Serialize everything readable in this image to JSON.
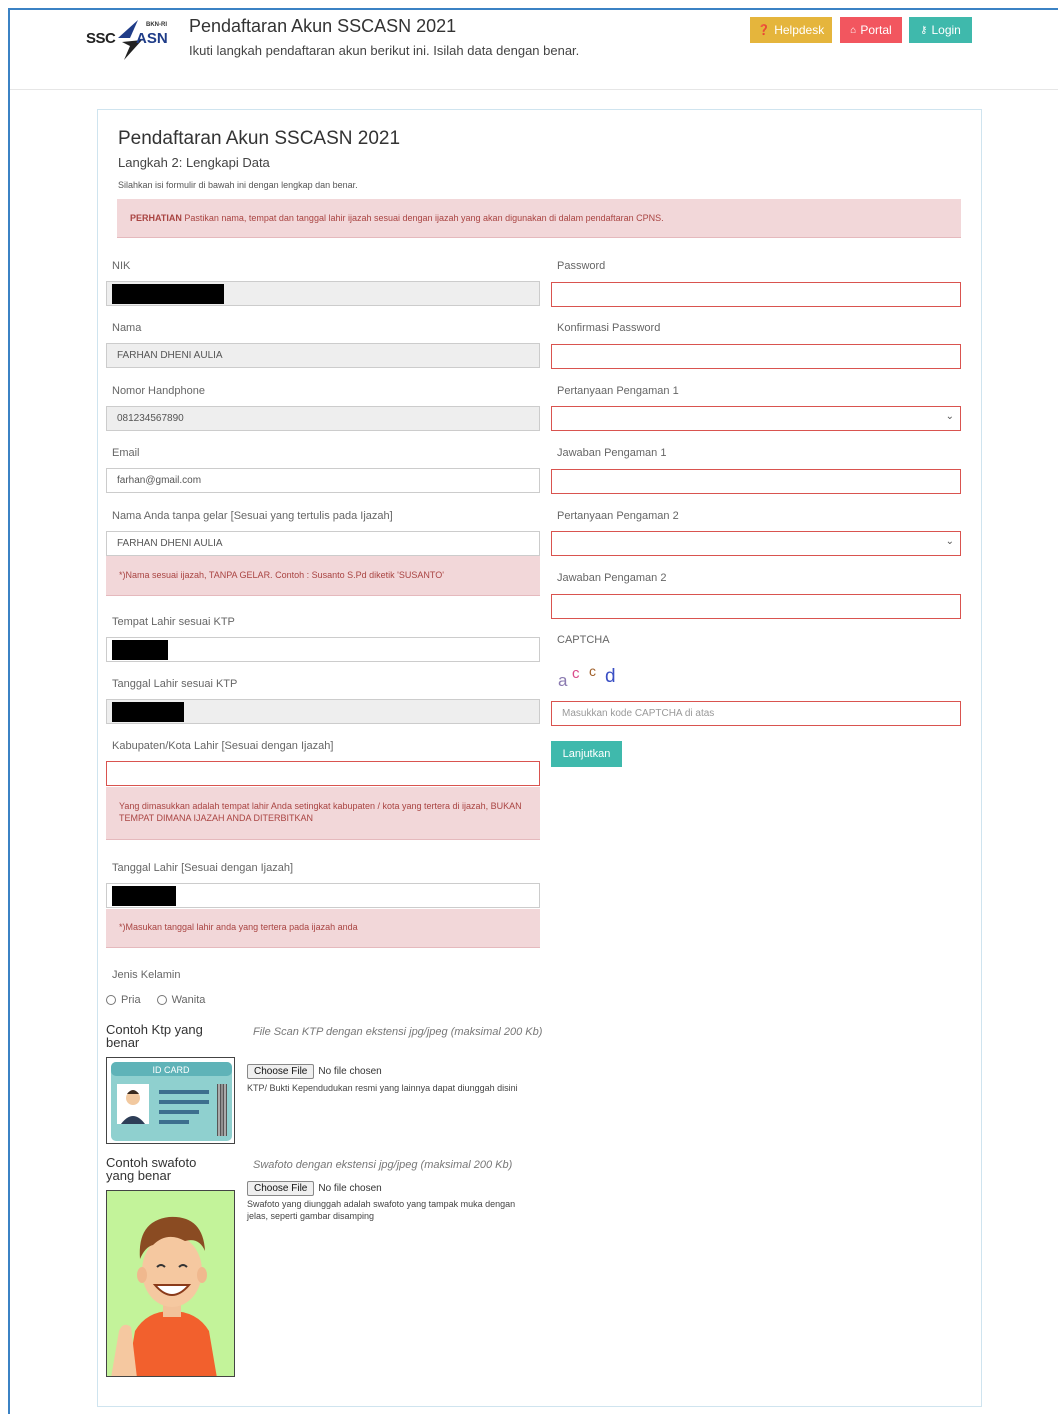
{
  "header": {
    "logo_left": "SSC",
    "logo_right": "ASN",
    "logo_small": "BKN-RI",
    "title": "Pendaftaran Akun SSCASN 2021",
    "subtitle": "Ikuti langkah pendaftaran akun berikut ini. Isilah data dengan benar.",
    "buttons": {
      "helpdesk": "Helpdesk",
      "portal": "Portal",
      "login": "Login"
    },
    "colors": {
      "helpdesk": "#e5b53c",
      "portal": "#f2565f",
      "login": "#3fb9ac"
    }
  },
  "form": {
    "title": "Pendaftaran Akun SSCASN 2021",
    "step": "Langkah 2: Lengkapi Data",
    "instruction": "Silahkan isi formulir di bawah ini dengan lengkap dan benar.",
    "alert_label": "PERHATIAN",
    "alert_text": "Pastikan nama, tempat dan tanggal lahir ijazah sesuai dengan ijazah yang akan digunakan di dalam pendaftaran CPNS.",
    "left": {
      "nik_label": "NIK",
      "nama_label": "Nama",
      "nama_value": "FARHAN DHENI AULIA",
      "hp_label": "Nomor Handphone",
      "hp_value": "081234567890",
      "email_label": "Email",
      "email_value": "farhan@gmail.com",
      "nama_ijazah_label": "Nama Anda tanpa gelar [Sesuai yang tertulis pada Ijazah]",
      "nama_ijazah_value": "FARHAN DHENI AULIA",
      "nama_ijazah_help": "*)Nama sesuai ijazah, TANPA GELAR. Contoh : Susanto S.Pd diketik 'SUSANTO'",
      "tempat_lahir_label": "Tempat Lahir sesuai KTP",
      "tanggal_lahir_label": "Tanggal Lahir sesuai KTP",
      "kab_label": "Kabupaten/Kota Lahir [Sesuai dengan Ijazah]",
      "kab_help": "Yang dimasukkan adalah tempat lahir Anda setingkat kabupaten / kota yang tertera di ijazah, BUKAN TEMPAT DIMANA IJAZAH ANDA DITERBITKAN",
      "tgl_ijazah_label": "Tanggal Lahir [Sesuai dengan Ijazah]",
      "tgl_ijazah_help": "*)Masukan tanggal lahir anda yang tertera pada ijazah anda",
      "gender_label": "Jenis Kelamin",
      "gender_options": [
        "Pria",
        "Wanita"
      ],
      "ktp_example_title": "Contoh Ktp yang benar",
      "ktp_desc": "File Scan KTP dengan ekstensi jpg/jpeg (maksimal 200 Kb)",
      "ktp_note": "KTP/ Bukti Kependudukan resmi yang lainnya dapat diunggah disini",
      "ktp_card_label": "ID CARD",
      "swafoto_example_title": "Contoh swafoto yang benar",
      "swafoto_desc": "Swafoto dengan ekstensi jpg/jpeg (maksimal 200 Kb)",
      "swafoto_note": "Swafoto yang diunggah adalah swafoto yang tampak muka dengan jelas, seperti gambar disamping",
      "choose_file": "Choose File",
      "no_file": "No file chosen"
    },
    "right": {
      "password_label": "Password",
      "konfirmasi_label": "Konfirmasi Password",
      "pertanyaan1_label": "Pertanyaan Pengaman 1",
      "jawaban1_label": "Jawaban Pengaman 1",
      "pertanyaan2_label": "Pertanyaan Pengaman 2",
      "jawaban2_label": "Jawaban Pengaman 2",
      "captcha_label": "CAPTCHA",
      "captcha_chars": [
        "a",
        "c",
        "c",
        "d"
      ],
      "captcha_placeholder": "Masukkan kode CAPTCHA di atas",
      "submit": "Lanjutkan"
    }
  }
}
